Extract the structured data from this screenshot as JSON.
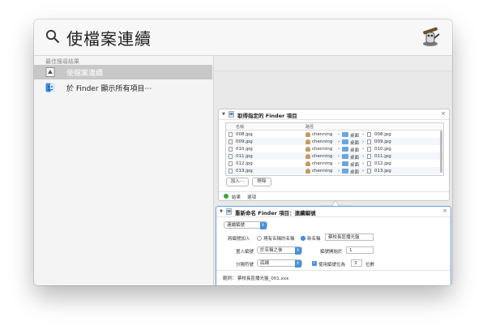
{
  "search": {
    "query": "使檔案連續"
  },
  "left": {
    "section_label": "最佳搜尋結果",
    "results": [
      {
        "label": "使檔案連續",
        "selected": true
      },
      {
        "label": "於 Finder 顯示所有項目⋯",
        "selected": false
      }
    ]
  },
  "panel1": {
    "title": "取得指定的 Finder 項目",
    "close": "×",
    "columns": [
      "名稱",
      "路徑"
    ],
    "rows": [
      {
        "name": "008.jpg",
        "user": "chenning",
        "folder": "桌面",
        "file": "008.jpg"
      },
      {
        "name": "009.jpg",
        "user": "chenning",
        "folder": "桌面",
        "file": "009.jpg"
      },
      {
        "name": "010.jpg",
        "user": "chenning",
        "folder": "桌面",
        "file": "010.jpg"
      },
      {
        "name": "011.jpg",
        "user": "chenning",
        "folder": "桌面",
        "file": "011.jpg"
      },
      {
        "name": "012.jpg",
        "user": "chenning",
        "folder": "桌面",
        "file": "012.jpg"
      },
      {
        "name": "013.jpg",
        "user": "chenning",
        "folder": "桌面",
        "file": "013.jpg"
      }
    ],
    "sep": "›",
    "add_label": "加入⋯",
    "remove_label": "移除",
    "tab_results": "結果",
    "tab_options": "選項"
  },
  "panel2": {
    "title": "重新命名 Finder 項目：連續編號",
    "close": "×",
    "mode_value": "連續編號",
    "add_number_label": "將編號加入",
    "radio_old_label": "現有名稱的名稱",
    "radio_new_label": "新名稱",
    "new_name_value": "蔡校長區播光盤",
    "where_label": "置入編號",
    "where_value": "於名稱之後",
    "start_label": "編號開始於",
    "start_value": "1",
    "separator_label": "分隔符號",
    "separator_value": "底線",
    "digits_check_label": "使用編號位為",
    "digits_value": "3",
    "digits_unit": "位數",
    "example_label": "範例：",
    "example_value": "蔡校長區播光盤_001.xxx"
  }
}
